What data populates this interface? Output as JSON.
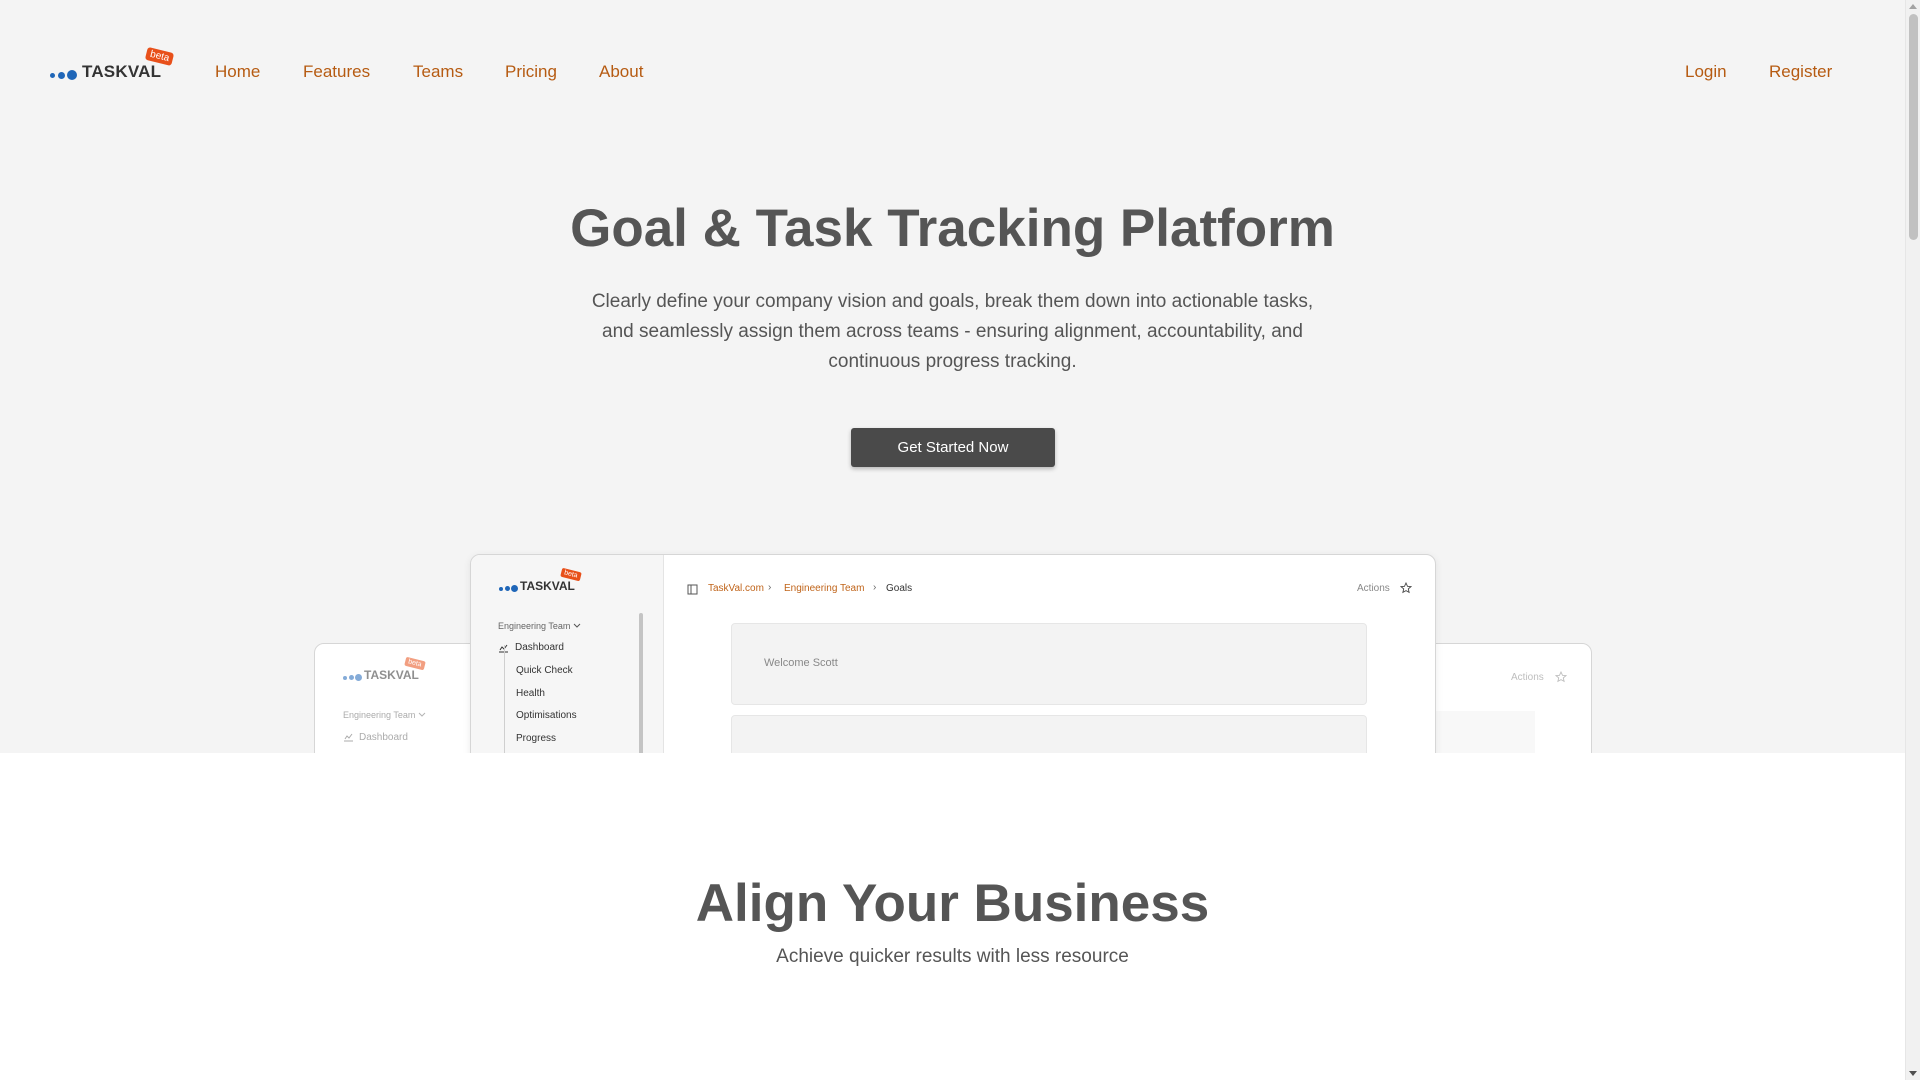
{
  "brand": {
    "name": "TASKVAL",
    "badge": "beta"
  },
  "nav": {
    "links": [
      "Home",
      "Features",
      "Teams",
      "Pricing",
      "About"
    ],
    "auth": {
      "login": "Login",
      "register": "Register"
    }
  },
  "hero": {
    "title": "Goal & Task Tracking Platform",
    "description": "Clearly define your company vision and goals, break them down into actionable tasks, and seamlessly assign them across teams - ensuring alignment, accountability, and continuous progress tracking.",
    "cta": "Get Started Now"
  },
  "mockup": {
    "front": {
      "team": "Engineering Team",
      "menu": [
        "Dashboard",
        "Quick Check",
        "Health",
        "Optimisations",
        "Progress"
      ],
      "breadcrumb": [
        "TaskVal.com",
        "Engineering Team",
        "Goals"
      ],
      "actions": "Actions",
      "welcome": "Welcome Scott"
    },
    "back": {
      "team": "Engineering Team",
      "menu_first": "Dashboard",
      "actions": "Actions"
    }
  },
  "section2": {
    "title": "Align Your Business",
    "subtitle": "Achieve quicker results with less resource"
  },
  "colors": {
    "link": "#b65b12",
    "brand_blue": "#1f66b8",
    "badge": "#e8501a",
    "cta": "#4a4a4a"
  },
  "icons": [
    "sidebar-toggle-icon",
    "chevron-right-icon",
    "star-icon",
    "chevron-down-icon",
    "chart-icon"
  ]
}
